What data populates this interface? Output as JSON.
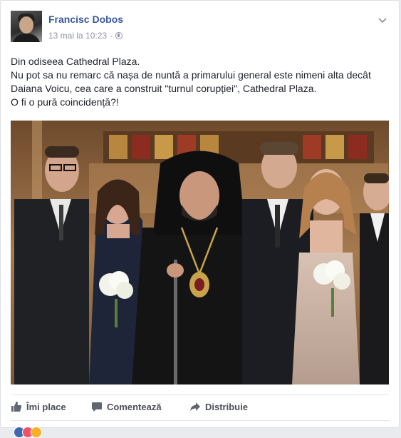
{
  "post": {
    "author": "Francisc Dobos",
    "timestamp": "13 mai la 10:23",
    "separator": "·",
    "privacy_icon": "globe-icon",
    "menu_icon": "chevron-down-icon",
    "text_lines": [
      "Din odiseea Cathedral Plaza.",
      "Nu pot sa nu remarc că nașa de nuntă a primarului general este nimeni alta decât Daiana Voicu, cea care a construit \"turnul corupției\", Cathedral Plaza.",
      "O fi o pură coincidență?!"
    ]
  },
  "actions": {
    "like_label": "Îmi place",
    "comment_label": "Comentează",
    "share_label": "Distribuie"
  },
  "colors": {
    "author_link": "#365899",
    "action_text": "#4b4f56",
    "meta_text": "#90949c",
    "like_reaction": "#4267b2",
    "love_reaction": "#f25268",
    "haha_reaction": "#f7b125"
  }
}
